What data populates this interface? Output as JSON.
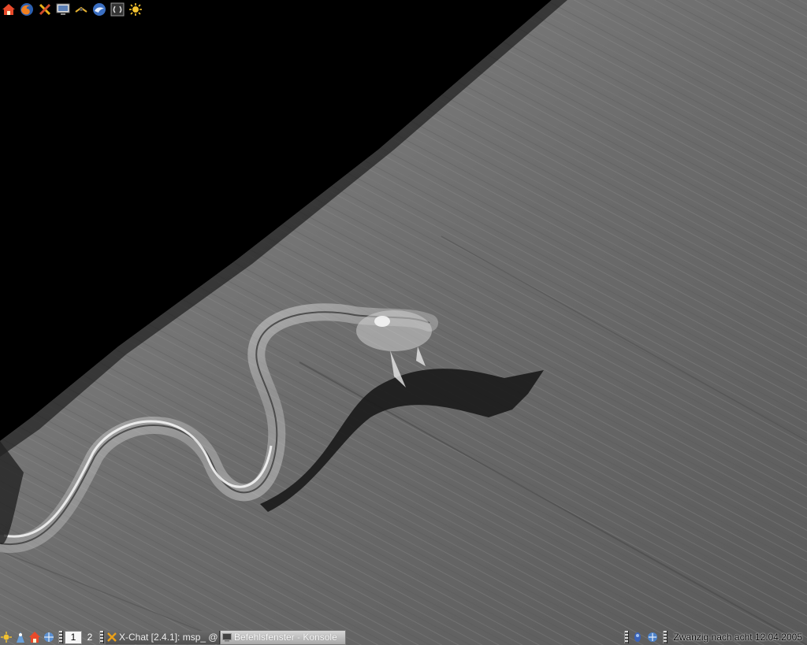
{
  "top_launcher": {
    "icons": [
      "home-icon",
      "firefox-icon",
      "tools-icon",
      "monitor-icon",
      "kde-sun-icon",
      "thunderbird-icon",
      "terminal-icon",
      "settings-sun-icon"
    ]
  },
  "panel": {
    "desktops": [
      "1",
      "2"
    ],
    "active_desktop": "1",
    "tasks": [
      {
        "label": "X-Chat [2.4.1]: msp_ @",
        "icon": "xchat-icon"
      },
      {
        "label": "Befehlsfenster - Konsole",
        "icon": "konsole-icon"
      }
    ],
    "clock": "Zwanzig nach acht 12.04.2005"
  },
  "colors": {
    "wallpaper_shadow": "#000000",
    "wallpaper_wood": "#6f6f6f",
    "panel_bg": "transparent"
  }
}
